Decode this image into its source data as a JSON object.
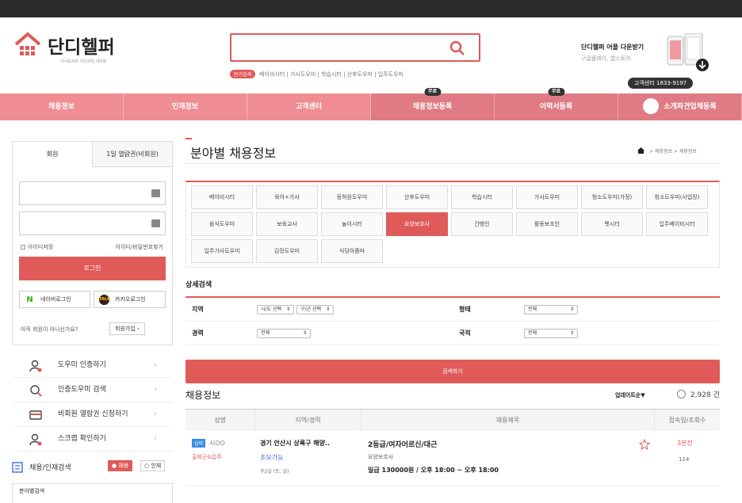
{
  "header": {
    "logo_title": "단디헬퍼",
    "logo_sub": "가사도우미 구인구직 사이트",
    "search_placeholder": "",
    "hot_badge": "인기검색",
    "hot_keywords": "베이비시터 | 가사도우미 | 학습시터 | 산후도우미 | 입주도우미",
    "app_title": "단디헬퍼 어플 다운받기",
    "app_sub": "구글플레이, 앱스토어",
    "cs": "고객센터 1833-9197"
  },
  "nav": {
    "items": [
      "채용정보",
      "인재정보",
      "고객센터",
      "채용정보등록",
      "이력서등록",
      "소개파견업체등록"
    ],
    "free_badge": "무료"
  },
  "login": {
    "tab_member": "회원",
    "tab_pass": "1일 열람권(비회원)",
    "save_id": "아이디저장",
    "find": "아이디/비밀번호찾기",
    "login_btn": "로그인",
    "naver": "네이버로그인",
    "kakao": "카카오로그인",
    "not_member": "아직 회원이 아니신가요?",
    "join": "회원가입"
  },
  "menu": [
    {
      "label": "도우미 인증하기"
    },
    {
      "label": "인증도우미 검색"
    },
    {
      "label": "비회원 열람권 신청하기"
    },
    {
      "label": "스크랩 확인하기"
    }
  ],
  "switch": {
    "label": "채용/인재검색",
    "a": "채용",
    "b": "인재"
  },
  "sub_box": "분야별검색",
  "main": {
    "title": "분야별 채용정보",
    "crumb": "> 채용정보 > 채용정보",
    "categories": [
      "베이비시터",
      "육아+가사",
      "등하원도우미",
      "산후도우미",
      "학습시터",
      "가사도우미",
      "청소도우미(가정)",
      "청소도우미(사업장)",
      "음식도우미",
      "보육교사",
      "놀이시터",
      "요양보호사",
      "간병인",
      "활동보조인",
      "펫시터",
      "입주베이비시터",
      "입주가사도우미",
      "김장도우미",
      "식당아줌마"
    ],
    "active_category": "요양보호사",
    "detail_title": "상세검색",
    "detail": {
      "region": "지역",
      "sido": "시/도 선택",
      "gugun": "구/군 선택",
      "type": "형태",
      "type_val": "전체",
      "career": "경력",
      "career_val": "전체",
      "nationality": "국적",
      "nationality_val": "전체"
    },
    "search_btn": "검색하기",
    "list_title": "채용정보",
    "sort": "업데이트순▼",
    "count": "2,928 건",
    "columns": [
      "성명",
      "지역/경력",
      "채용제목",
      "접속일/조회수"
    ],
    "rows": [
      {
        "badge": "입력",
        "name": "시OO",
        "schedule": "출퇴근&입주",
        "location": "경기 안산시 상록구 해양..",
        "experience": "초보가능",
        "days": "주2일 (토, 일)",
        "job": "2등급/여자어르신/대근",
        "type": "요양보호사",
        "pay": "일급 130000원 / 오후 18:00 ~ 오후 18:00",
        "time": "3분전",
        "views": "114"
      }
    ]
  },
  "colors": {
    "accent": "#e05a5a",
    "nav": "#ef8d93",
    "badge": "#3a8ee6"
  }
}
